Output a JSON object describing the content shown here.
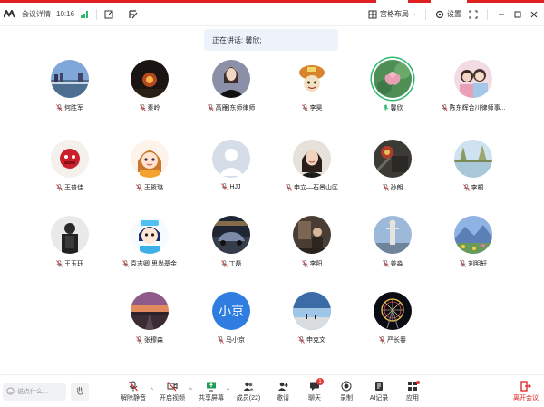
{
  "titlebar": {
    "meeting_details": "会议详情",
    "time": "10:16",
    "layout_label": "宫格布局",
    "settings_label": "设置"
  },
  "speaking_banner": "正在讲话: 馨欣;",
  "participants": [
    {
      "name": "何胜军",
      "avatar": "city-river",
      "muted": true
    },
    {
      "name": "秦岭",
      "avatar": "night-dark",
      "muted": true
    },
    {
      "name": "高雁|东师律师",
      "avatar": "woman-portrait",
      "muted": true
    },
    {
      "name": "李昊",
      "avatar": "cartoon-mushroom",
      "muted": true
    },
    {
      "name": "馨欣",
      "avatar": "lotus-flower",
      "muted": false,
      "speaking": true
    },
    {
      "name": "陈东辉合川律师事...",
      "avatar": "two-girls",
      "muted": true
    },
    {
      "name": "王普佳",
      "avatar": "red-cartoon",
      "muted": true
    },
    {
      "name": "王筱璐",
      "avatar": "anime-girl",
      "muted": true
    },
    {
      "name": "HJJ",
      "avatar": "default-person",
      "muted": true
    },
    {
      "name": "申立—石景山区",
      "avatar": "woman-smile",
      "muted": true
    },
    {
      "name": "孙朗",
      "avatar": "dark-object",
      "muted": true
    },
    {
      "name": "李桐",
      "avatar": "lake-trees",
      "muted": true
    },
    {
      "name": "王玉珏",
      "avatar": "man-dark",
      "muted": true
    },
    {
      "name": "袁志卿 思尚基金",
      "avatar": "cartoon-blue",
      "muted": true
    },
    {
      "name": "丁磊",
      "avatar": "car-dark",
      "muted": true
    },
    {
      "name": "李阳",
      "avatar": "room-person",
      "muted": true
    },
    {
      "name": "姜淼",
      "avatar": "statue-sky",
      "muted": true
    },
    {
      "name": "刘明轩",
      "avatar": "mountain-flowers",
      "muted": true
    },
    {
      "name": "张穆森",
      "avatar": "sunset-road",
      "muted": true
    },
    {
      "name": "马小京",
      "avatar": "text-avatar",
      "avatar_text": "小京",
      "muted": true
    },
    {
      "name": "申克文",
      "avatar": "beach-sky",
      "muted": true
    },
    {
      "name": "严长春",
      "avatar": "ferris-wheel",
      "muted": true
    }
  ],
  "bottombar": {
    "say_placeholder": "说点什么...",
    "tools": [
      {
        "label": "解除静音",
        "icon": "mic-off-icon"
      },
      {
        "label": "开启视频",
        "icon": "video-off-icon"
      },
      {
        "label": "共享屏幕",
        "icon": "share-screen-icon"
      },
      {
        "label": "成员(22)",
        "icon": "members-icon"
      },
      {
        "label": "邀请",
        "icon": "invite-icon"
      },
      {
        "label": "聊天",
        "icon": "chat-icon",
        "badge": "1"
      },
      {
        "label": "录制",
        "icon": "record-icon"
      },
      {
        "label": "AI记录",
        "icon": "ai-record-icon"
      },
      {
        "label": "应用",
        "icon": "apps-icon"
      }
    ],
    "leave_label": "离开会议"
  },
  "colors": {
    "accent_red": "#e02020",
    "speaking_green": "#2eb872",
    "banner_bg": "#eef2fb",
    "text_avatar_bg": "#2f7de1"
  }
}
